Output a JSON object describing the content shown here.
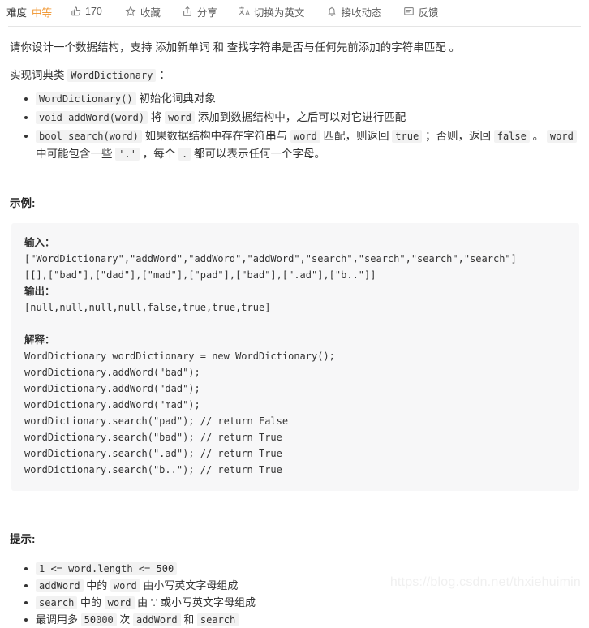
{
  "action_bar": {
    "difficulty_label": "难度",
    "difficulty_value": "中等",
    "difficulty_color": "#f0932b",
    "items": [
      {
        "icon": "thumbs-up-icon",
        "label": "170"
      },
      {
        "icon": "star-icon",
        "label": "收藏"
      },
      {
        "icon": "share-icon",
        "label": "分享"
      },
      {
        "icon": "translate-icon",
        "label": "切换为英文"
      },
      {
        "icon": "bell-icon",
        "label": "接收动态"
      },
      {
        "icon": "feedback-icon",
        "label": "反馈"
      }
    ]
  },
  "description": {
    "intro": "请你设计一个数据结构，支持 添加新单词 和 查找字符串是否与任何先前添加的字符串匹配 。",
    "implement_prefix": "实现词典类",
    "implement_code": "WordDictionary",
    "implement_suffix": "：",
    "api": [
      {
        "code": "WordDictionary()",
        "text": "初始化词典对象"
      },
      {
        "code": "void addWord(word)",
        "text_a": "将",
        "code_b": "word",
        "text_b": "添加到数据结构中，之后可以对它进行匹配"
      },
      {
        "code": "bool search(word)",
        "t1": "如果数据结构中存在字符串与",
        "c1": "word",
        "t2": "匹配，则返回",
        "c2": "true",
        "t3": "；否则，返回",
        "c3": "false",
        "t4": "。",
        "c4": "word",
        "t5": "中可能包含一些",
        "c5": "'.'",
        "t6": "，每个",
        "c6": ".",
        "t7": "都可以表示任何一个字母。"
      }
    ]
  },
  "examples": {
    "title": "示例:",
    "input_label": "输入：",
    "input_lines": [
      "[\"WordDictionary\",\"addWord\",\"addWord\",\"addWord\",\"search\",\"search\",\"search\",\"search\"]",
      "[[],[\"bad\"],[\"dad\"],[\"mad\"],[\"pad\"],[\"bad\"],[\".ad\"],[\"b..\"]]"
    ],
    "output_label": "输出：",
    "output_lines": [
      "[null,null,null,null,false,true,true,true]"
    ],
    "explanation_label": "解释：",
    "explanation_lines": [
      "WordDictionary wordDictionary = new WordDictionary();",
      "wordDictionary.addWord(\"bad\");",
      "wordDictionary.addWord(\"dad\");",
      "wordDictionary.addWord(\"mad\");",
      "wordDictionary.search(\"pad\"); // return False",
      "wordDictionary.search(\"bad\"); // return True",
      "wordDictionary.search(\".ad\"); // return True",
      "wordDictionary.search(\"b..\"); // return True"
    ]
  },
  "hints": {
    "title": "提示:",
    "items": [
      {
        "c1": "1 <= word.length <= 500"
      },
      {
        "c1": "addWord",
        "t1": "中的",
        "c2": "word",
        "t2": "由小写英文字母组成"
      },
      {
        "c1": "search",
        "t1": "中的",
        "c2": "word",
        "t2": "由 '.' 或小写英文字母组成"
      },
      {
        "t0": "最调用多",
        "c1": "50000",
        "t1": "次",
        "c2": "addWord",
        "t2": "和",
        "c3": "search"
      }
    ]
  },
  "watermark": "https://blog.csdn.net/thxiehuimin"
}
